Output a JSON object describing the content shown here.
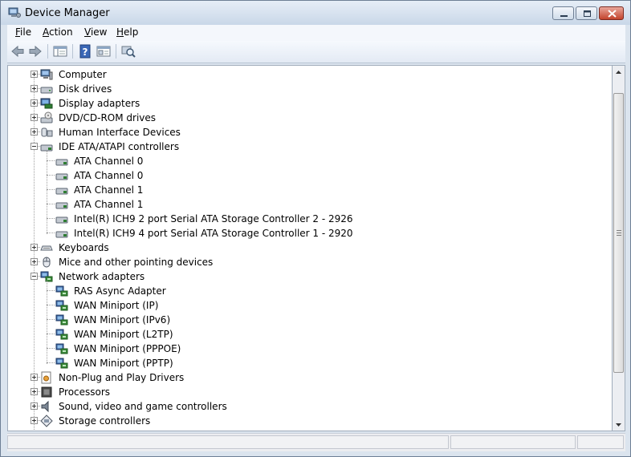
{
  "window": {
    "title": "Device Manager",
    "icon": "device-manager-icon"
  },
  "menu": [
    {
      "label": "File",
      "key": "F"
    },
    {
      "label": "Action",
      "key": "A"
    },
    {
      "label": "View",
      "key": "V"
    },
    {
      "label": "Help",
      "key": "H"
    }
  ],
  "toolbar": [
    {
      "name": "back-button",
      "icon": "arrow-left-icon"
    },
    {
      "name": "forward-button",
      "icon": "arrow-right-icon"
    },
    {
      "name": "show-hide-console-tree-button",
      "icon": "console-tree-icon"
    },
    {
      "name": "help-button",
      "icon": "help-icon"
    },
    {
      "name": "properties-button",
      "icon": "properties-icon"
    },
    {
      "name": "scan-hardware-button",
      "icon": "scan-hardware-icon"
    }
  ],
  "tree": {
    "categories": [
      {
        "label": "Computer",
        "expanded": false,
        "icon": "computer-icon"
      },
      {
        "label": "Disk drives",
        "expanded": false,
        "icon": "disk-drive-icon"
      },
      {
        "label": "Display adapters",
        "expanded": false,
        "icon": "display-adapter-icon"
      },
      {
        "label": "DVD/CD-ROM drives",
        "expanded": false,
        "icon": "dvd-drive-icon"
      },
      {
        "label": "Human Interface Devices",
        "expanded": false,
        "icon": "hid-icon"
      },
      {
        "label": "IDE ATA/ATAPI controllers",
        "expanded": true,
        "icon": "ide-controller-icon",
        "children": [
          "ATA Channel 0",
          "ATA Channel 0",
          "ATA Channel 1",
          "ATA Channel 1",
          "Intel(R) ICH9 2 port Serial ATA Storage Controller 2 - 2926",
          "Intel(R) ICH9 4 port Serial ATA Storage Controller 1 - 2920"
        ]
      },
      {
        "label": "Keyboards",
        "expanded": false,
        "icon": "keyboard-icon"
      },
      {
        "label": "Mice and other pointing devices",
        "expanded": false,
        "icon": "mouse-icon"
      },
      {
        "label": "Network adapters",
        "expanded": true,
        "icon": "network-adapter-icon",
        "children": [
          "RAS Async Adapter",
          "WAN Miniport (IP)",
          "WAN Miniport (IPv6)",
          "WAN Miniport (L2TP)",
          "WAN Miniport (PPPOE)",
          "WAN Miniport (PPTP)"
        ]
      },
      {
        "label": "Non-Plug and Play Drivers",
        "expanded": false,
        "icon": "non-pnp-driver-icon"
      },
      {
        "label": "Processors",
        "expanded": false,
        "icon": "processor-icon"
      },
      {
        "label": "Sound, video and game controllers",
        "expanded": false,
        "icon": "sound-icon"
      },
      {
        "label": "Storage controllers",
        "expanded": false,
        "icon": "storage-controller-icon"
      }
    ]
  },
  "colors": {
    "title_gradient_top": "#e6eef7",
    "title_gradient_bottom": "#c9d7e8",
    "close_button": "#c3432c"
  }
}
